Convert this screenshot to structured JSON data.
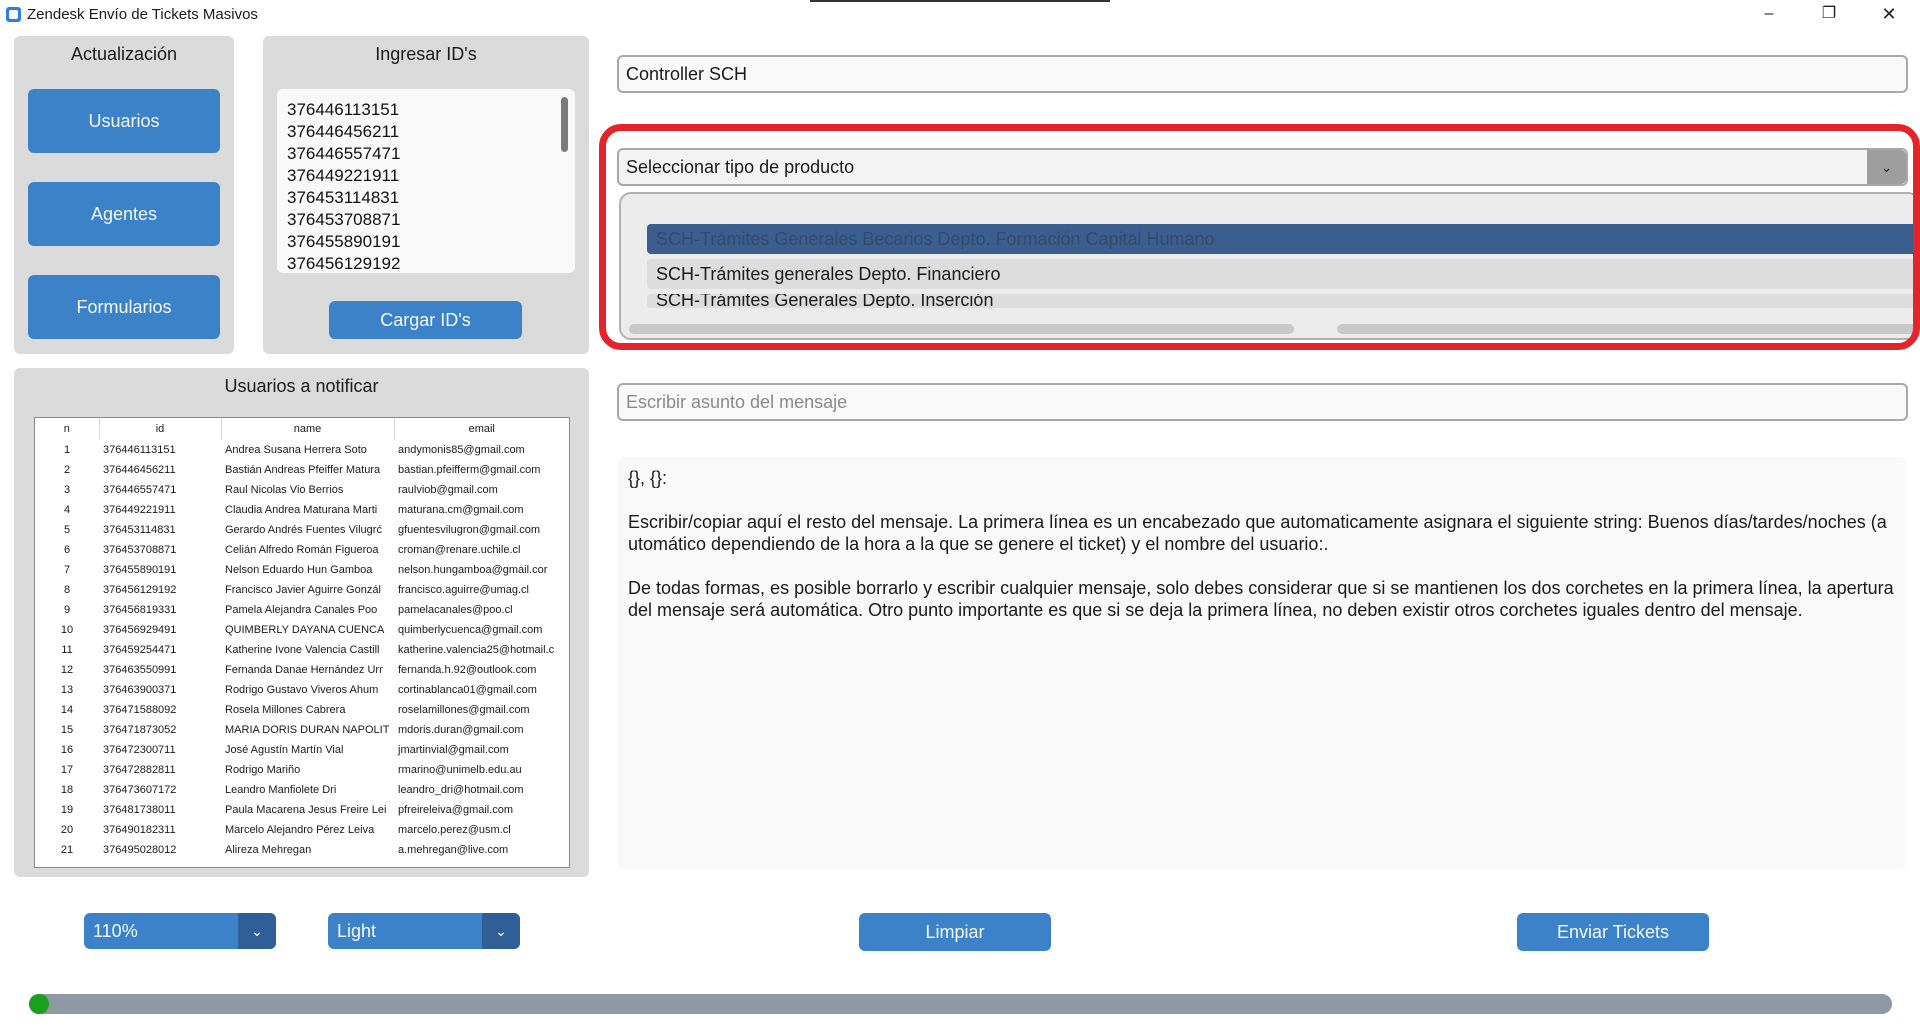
{
  "window": {
    "title": "Zendesk Envío de Tickets Masivos",
    "minimize": "–",
    "maximize": "❐",
    "close": "✕"
  },
  "update_panel": {
    "title": "Actualización",
    "buttons": [
      "Usuarios",
      "Agentes",
      "Formularios"
    ]
  },
  "ids_panel": {
    "title": "Ingresar ID's",
    "ids": [
      "376446113151",
      "376446456211",
      "376446557471",
      "376449221911",
      "376453114831",
      "376453708871",
      "376455890191",
      "376456129192"
    ],
    "load_button": "Cargar ID's"
  },
  "users_panel": {
    "title": "Usuarios a notificar",
    "columns": [
      "n",
      "id",
      "name",
      "email"
    ],
    "rows": [
      [
        "1",
        "376446113151",
        "Andrea Susana Herrera Soto",
        "andymonis85@gmail.com"
      ],
      [
        "2",
        "376446456211",
        "Bastián Andreas Pfeiffer Matura",
        "bastian.pfeifferm@gmail.com"
      ],
      [
        "3",
        "376446557471",
        "Raul Nicolas Vio Berrios",
        "raulviob@gmail.com"
      ],
      [
        "4",
        "376449221911",
        "Claudia Andrea Maturana Marti",
        "maturana.cm@gmail.com"
      ],
      [
        "5",
        "376453114831",
        "Gerardo Andrés Fuentes Vilugrć",
        "gfuentesvilugron@gmail.com"
      ],
      [
        "6",
        "376453708871",
        "Celián Alfredo Román Figueroa",
        "croman@renare.uchile.cl"
      ],
      [
        "7",
        "376455890191",
        "Nelson Eduardo Hun Gamboa",
        "nelson.hungamboa@gmail.cor"
      ],
      [
        "8",
        "376456129192",
        "Francisco Javier Aguirre Gonzál",
        "francisco.aguirre@umag.cl"
      ],
      [
        "9",
        "376456819331",
        "Pamela Alejandra Canales Poo",
        "pamelacanales@poo.cl"
      ],
      [
        "10",
        "376456929491",
        "QUIMBERLY DAYANA CUENCA",
        "quimberlycuenca@gmail.com"
      ],
      [
        "11",
        "376459254471",
        "Katherine Ivone Valencia Castill",
        "katherine.valencia25@hotmail.c"
      ],
      [
        "12",
        "376463550991",
        "Fernanda Danae Hernández Urr",
        "fernanda.h.92@outlook.com"
      ],
      [
        "13",
        "376463900371",
        "Rodrigo Gustavo Viveros Ahum",
        "cortinablanca01@gmail.com"
      ],
      [
        "14",
        "376471588092",
        "Rosela Millones Cabrera",
        "roselamillones@gmail.com"
      ],
      [
        "15",
        "376471873052",
        "MARIA DORIS DURAN NAPOLIT",
        "mdoris.duran@gmail.com"
      ],
      [
        "16",
        "376472300711",
        "José Agustín Martín Vial",
        "jmartinvial@gmail.com"
      ],
      [
        "17",
        "376472882811",
        "Rodrigo Mariño",
        "rmarino@unimelb.edu.au"
      ],
      [
        "18",
        "376473607172",
        "Leandro Manfiolete Dri",
        "leandro_dri@hotmail.com"
      ],
      [
        "19",
        "376481738011",
        "Paula Macarena Jesus Freire Lei",
        "pfreireleiva@gmail.com"
      ],
      [
        "20",
        "376490182311",
        "Marcelo Alejandro Pérez Leiva",
        "marcelo.perez@usm.cl"
      ],
      [
        "21",
        "376495028012",
        "Alireza Mehregan",
        "a.mehregan@live.com"
      ]
    ]
  },
  "controller_field": {
    "value": "Controller SCH"
  },
  "product_select": {
    "value": "Seleccionar tipo de producto",
    "arrow": "⌄",
    "options": [
      "SCH-Trámites Generales Becarios Depto. Formación Capital Humano",
      "SCH-Trámites generales Depto. Financiero",
      "SCH-Trámites Generales Depto. Inserción"
    ]
  },
  "subject_field": {
    "placeholder": "Escribir asunto del mensaje"
  },
  "message": {
    "lines": [
      "{}, {}:",
      "Escribir/copiar aquí el resto del mensaje. La primera línea es un encabezado que automaticamente asignara el siguiente string: Buenos días/tardes/noches (automático dependiendo de la hora a la que se genere el ticket) y el nombre del usuario:.",
      "De todas formas, es posible borrarlo y escribir cualquier mensaje, solo debes considerar que si se mantienen los dos corchetes en la primera línea, la apertura del mensaje será automática. Otro punto importante es que si se deja la primera línea, no deben existir otros corchetes iguales dentro del mensaje."
    ]
  },
  "bottom": {
    "zoom": "110%",
    "theme": "Light",
    "clear_button": "Limpiar",
    "send_button": "Enviar Tickets",
    "arrow": "⌄"
  },
  "progress": {
    "value": 0.005,
    "color": "#19a11e"
  },
  "colors": {
    "accent": "#3b82c9",
    "highlight": "#e3242b",
    "frame": "#dbdbdb"
  }
}
